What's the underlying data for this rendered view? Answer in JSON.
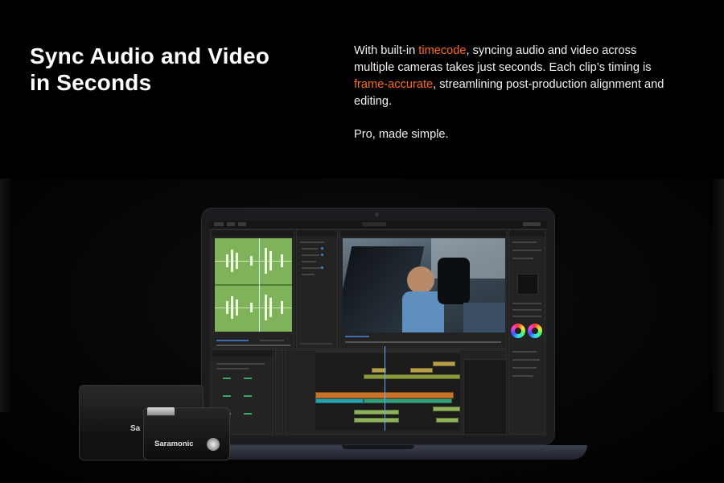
{
  "hero": {
    "title_line1": "Sync Audio and Video",
    "title_line2": "in Seconds",
    "para_1": "With built-in ",
    "highlight_1": "timecode",
    "para_2": ", syncing audio and video across multiple cameras takes just seconds. Each clip’s timing is ",
    "highlight_2": "frame-accurate",
    "para_3": ", streamlining post-production alignment and editing.",
    "tagline": "Pro, made simple."
  },
  "devices": {
    "receiver_brand": "Sa",
    "transmitter_brand": "Saramonic"
  },
  "colors": {
    "accent": "#ff6a1a",
    "waveform": "#7fb35a",
    "background": "#000000"
  },
  "icons": [
    "video-editor-screen",
    "color-wheel-icon",
    "power-button-icon"
  ]
}
